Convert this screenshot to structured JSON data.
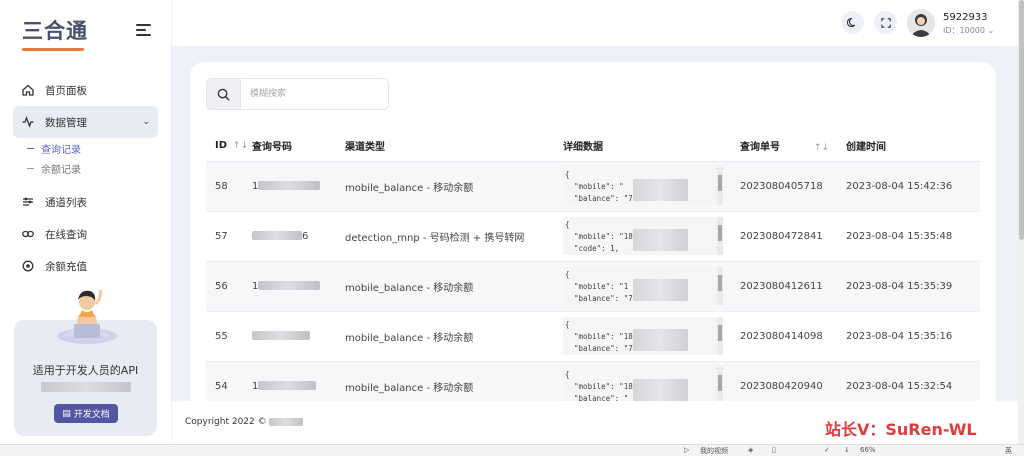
{
  "brand": {
    "logo_text": "三合通"
  },
  "sidebar": {
    "items": [
      {
        "label": "首页面板",
        "icon": "home-icon"
      },
      {
        "label": "数据管理",
        "icon": "activity-icon",
        "expanded": true
      },
      {
        "label": "通道列表",
        "icon": "sliders-icon"
      },
      {
        "label": "在线查询",
        "icon": "link-icon"
      },
      {
        "label": "余额充值",
        "icon": "target-icon"
      }
    ],
    "sub_items": [
      {
        "label": "查询记录",
        "active": true
      },
      {
        "label": "余额记录",
        "active": false
      }
    ],
    "api_card": {
      "title": "适用于开发人员的API",
      "button": "开发文档"
    }
  },
  "header": {
    "user": {
      "name": "5922933",
      "id_text": "ID：10000"
    }
  },
  "search": {
    "placeholder": "模糊搜索"
  },
  "table": {
    "columns": [
      "ID",
      "查询号码",
      "渠道类型",
      "详细数据",
      "查询单号",
      "创建时间"
    ],
    "rows": [
      {
        "id": "58",
        "mobile_prefix": "1",
        "mobile_suffix": "",
        "channel": "mobile_balance - 移动余额",
        "detail": "{\n  \"mobile\": \"\n  \"balance\": \"7",
        "order": "2023080405718",
        "time": "2023-08-04 15:42:36"
      },
      {
        "id": "57",
        "mobile_prefix": "",
        "mobile_suffix": "6",
        "channel": "detection_mnp - 号码检测 + 携号转网",
        "detail": "{\n  \"mobile\": \"18\n  \"code\": 1,",
        "order": "2023080472841",
        "time": "2023-08-04 15:35:48"
      },
      {
        "id": "56",
        "mobile_prefix": "1",
        "mobile_suffix": "",
        "channel": "mobile_balance - 移动余额",
        "detail": "{\n  \"mobile\": \"1\n  \"balance\": \"77",
        "order": "2023080412611",
        "time": "2023-08-04 15:35:39"
      },
      {
        "id": "55",
        "mobile_prefix": "",
        "mobile_suffix": "",
        "channel": "mobile_balance - 移动余额",
        "detail": "{\n  \"mobile\": \"18\n  \"balance\": \"7",
        "order": "2023080414098",
        "time": "2023-08-04 15:35:16"
      },
      {
        "id": "54",
        "mobile_prefix": "1",
        "mobile_suffix": "",
        "channel": "mobile_balance - 移动余额",
        "detail": "{\n  \"mobile\": \"18\n  \"balance\": \"",
        "order": "2023080420940",
        "time": "2023-08-04 15:32:54"
      }
    ]
  },
  "footer": {
    "copyright": "Copyright 2022 ©"
  },
  "watermark": "站长V：SuRen-WL",
  "taskbar": {
    "video_label": "我的视频",
    "zoom": "66%",
    "lang": "英"
  },
  "colors": {
    "accent": "#5158a1",
    "logo_underline": "#e97a3a",
    "watermark": "#e03c3c"
  }
}
